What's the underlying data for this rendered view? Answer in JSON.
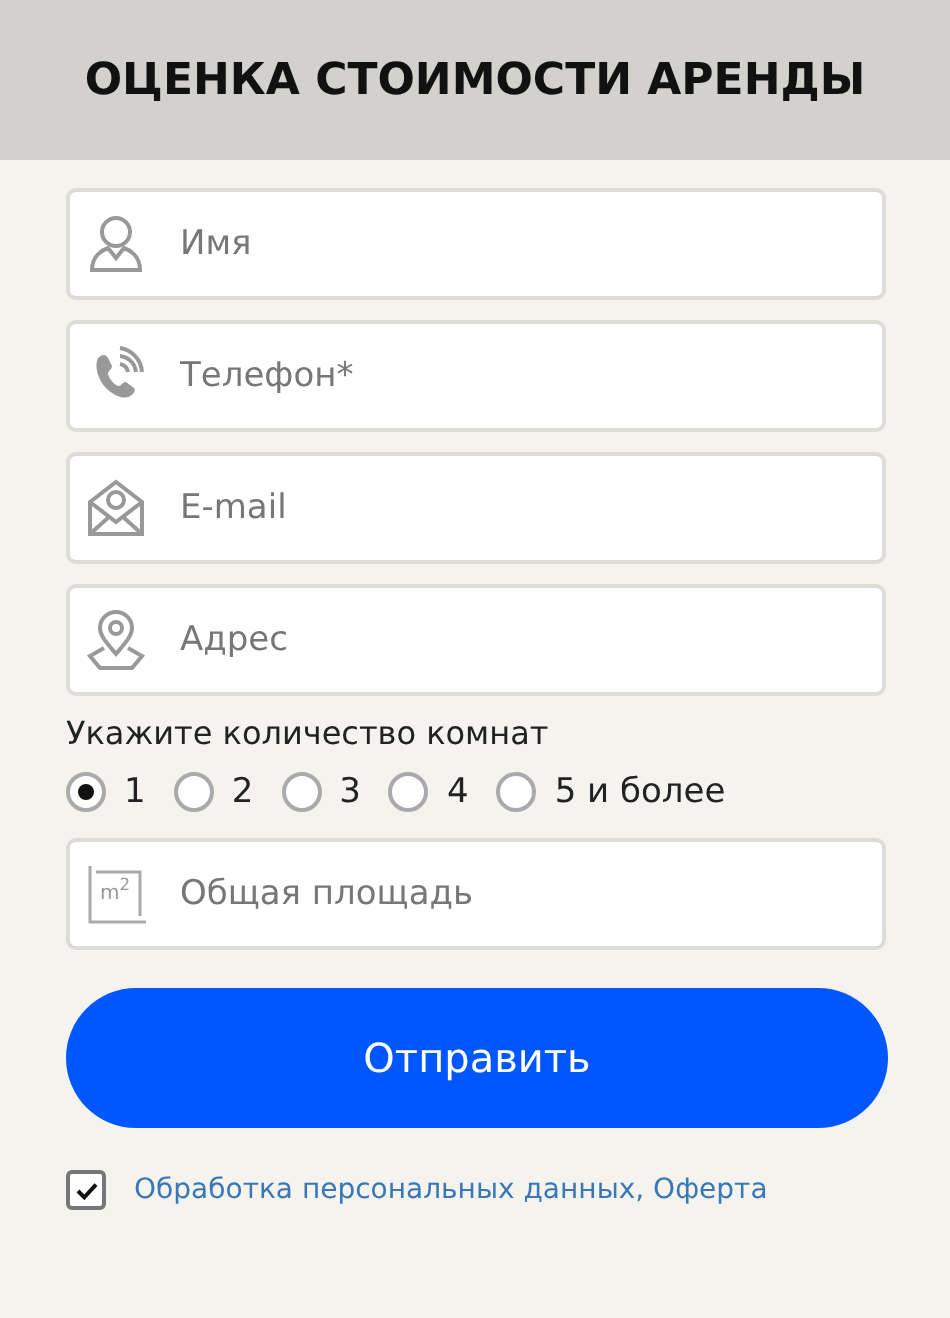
{
  "title": "ОЦЕНКА СТОИМОСТИ АРЕНДЫ",
  "fields": [
    {
      "kind": "person",
      "placeholder": "Имя"
    },
    {
      "kind": "phone",
      "placeholder": "Телефон*"
    },
    {
      "kind": "mail",
      "placeholder": "E-mail"
    },
    {
      "kind": "pin",
      "placeholder": "Адрес"
    }
  ],
  "rooms": {
    "label": "Укажите количество комнат",
    "options": [
      {
        "label": "1",
        "selected": true
      },
      {
        "label": "2",
        "selected": false
      },
      {
        "label": "3",
        "selected": false
      },
      {
        "label": "4",
        "selected": false
      },
      {
        "label": "5 и более",
        "selected": false
      }
    ]
  },
  "area": {
    "kind": "area",
    "unit": "m$^{2}$",
    "placeholder": "Общая площадь"
  },
  "submit": "Отправить",
  "consent": {
    "checked": true,
    "link": "Обработка персональных данных, Оферта"
  }
}
